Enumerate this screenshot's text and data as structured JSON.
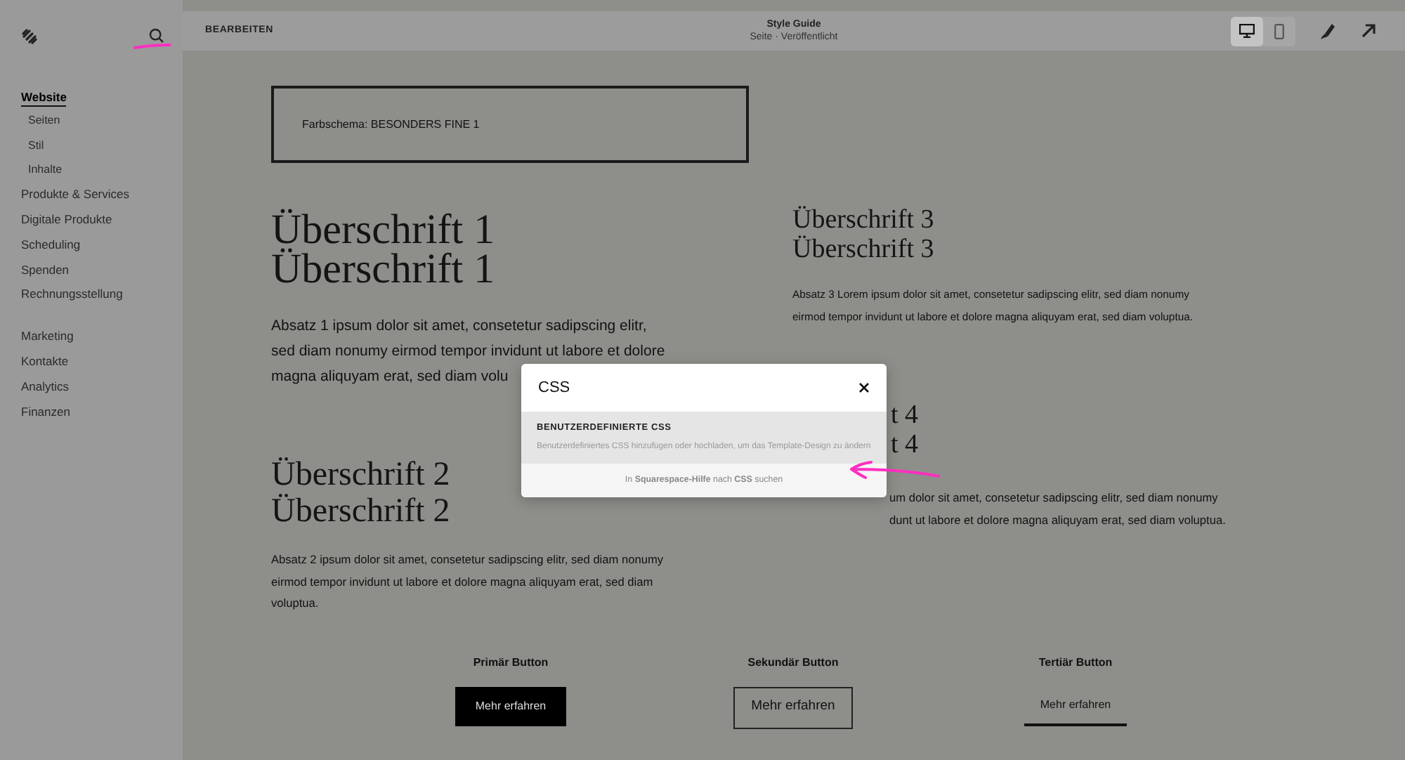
{
  "sidebar": {
    "groups": [
      {
        "items": [
          {
            "label": "Website",
            "selected": true,
            "children": [
              {
                "label": "Seiten",
                "selected": false
              },
              {
                "label": "Stil",
                "selected": false
              },
              {
                "label": "Inhalte",
                "selected": false
              }
            ]
          },
          {
            "label": "Produkte & Services",
            "selected": false
          },
          {
            "label": "Digitale Produkte",
            "selected": false
          },
          {
            "label": "Scheduling",
            "selected": false
          },
          {
            "label": "Spenden",
            "selected": false
          },
          {
            "label": "Rechnungsstellung",
            "selected": false
          }
        ]
      },
      {
        "items": [
          {
            "label": "Marketing",
            "selected": false
          },
          {
            "label": "Kontakte",
            "selected": false
          },
          {
            "label": "Analytics",
            "selected": false
          },
          {
            "label": "Finanzen",
            "selected": false
          }
        ]
      }
    ]
  },
  "topbar": {
    "edit_label": "BEARBEITEN",
    "title": "Style Guide",
    "subtitle": "Seite · Veröffentlicht",
    "devices": [
      {
        "kind": "desktop",
        "selected": true
      },
      {
        "kind": "mobile",
        "selected": false
      }
    ]
  },
  "page": {
    "color_scheme": "Farbschema: BESONDERS FINE 1",
    "heading_1": [
      "Überschrift 1",
      "Überschrift 1"
    ],
    "paragraph_1": [
      "Absatz 1 ipsum dolor sit amet, consetetur sadipscing elitr,",
      "sed diam nonumy eirmod tempor invidunt ut labore et dolore",
      "magna aliquyam erat, sed diam volu"
    ],
    "heading_2": [
      "Überschrift 2",
      "Überschrift 2"
    ],
    "paragraph_2": "Absatz 2 ipsum dolor sit amet, consetetur sadipscing elitr, sed diam nonumy eirmod tempor invidunt ut labore et dolore magna aliquyam erat, sed diam voluptua.",
    "heading_3": [
      "Überschrift 3",
      "Überschrift 3"
    ],
    "paragraph_3": "Absatz 3 Lorem ipsum dolor sit amet, consetetur sadipscing elitr, sed diam nonumy eirmod tempor invidunt ut labore et dolore magna aliquyam erat, sed diam voluptua.",
    "heading_4": [
      "t 4",
      "t 4"
    ],
    "paragraph_4": [
      "um dolor sit amet, consetetur sadipscing elitr, sed diam nonumy",
      "dunt ut labore et dolore magna aliquyam erat, sed diam voluptua."
    ],
    "buttons": [
      {
        "kind": "primary",
        "title": "Primär Button",
        "label": "Mehr erfahren"
      },
      {
        "kind": "secondary",
        "title": "Sekundär Button",
        "label": "Mehr erfahren"
      },
      {
        "kind": "tertiary",
        "title": "Tertiär Button",
        "label": "Mehr erfahren"
      }
    ]
  },
  "dialog": {
    "query": "CSS",
    "results": [
      {
        "title": "BENUTZERDEFINIERTE CSS",
        "description": "Benutzerdefiniertes CSS hinzufügen oder hochladen, um das Template-Design zu ändern",
        "selected": true
      }
    ],
    "footer": "In **Squarespace-Hilfe** nach **CSS** suchen"
  }
}
